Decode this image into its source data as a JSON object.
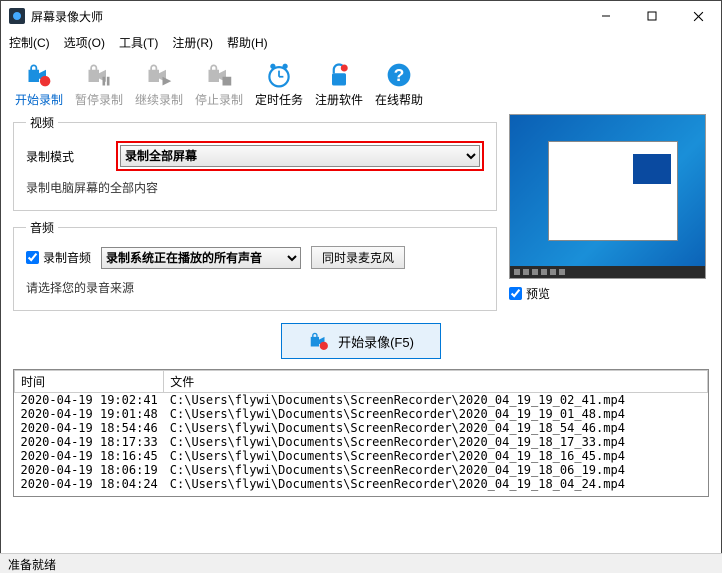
{
  "title": "屏幕录像大师",
  "menu": {
    "control": "控制(C)",
    "options": "选项(O)",
    "tools": "工具(T)",
    "register": "注册(R)",
    "help": "帮助(H)"
  },
  "toolbar": {
    "start": "开始录制",
    "pause": "暂停录制",
    "continue": "继续录制",
    "stop": "停止录制",
    "timer": "定时任务",
    "regsoft": "注册软件",
    "onlinehelp": "在线帮助"
  },
  "video": {
    "legend": "视频",
    "mode_label": "录制模式",
    "mode_value": "录制全部屏幕",
    "hint": "录制电脑屏幕的全部内容"
  },
  "audio": {
    "legend": "音频",
    "record_audio": "录制音频",
    "source_value": "录制系统正在播放的所有声音",
    "mic_btn": "同时录麦克风",
    "hint": "请选择您的录音来源"
  },
  "preview_label": "预览",
  "big_button": "开始录像(F5)",
  "list": {
    "col_time": "时间",
    "col_file": "文件",
    "rows": [
      {
        "time": "2020-04-19 19:02:41",
        "file": "C:\\Users\\flywi\\Documents\\ScreenRecorder\\2020_04_19_19_02_41.mp4"
      },
      {
        "time": "2020-04-19 19:01:48",
        "file": "C:\\Users\\flywi\\Documents\\ScreenRecorder\\2020_04_19_19_01_48.mp4"
      },
      {
        "time": "2020-04-19 18:54:46",
        "file": "C:\\Users\\flywi\\Documents\\ScreenRecorder\\2020_04_19_18_54_46.mp4"
      },
      {
        "time": "2020-04-19 18:17:33",
        "file": "C:\\Users\\flywi\\Documents\\ScreenRecorder\\2020_04_19_18_17_33.mp4"
      },
      {
        "time": "2020-04-19 18:16:45",
        "file": "C:\\Users\\flywi\\Documents\\ScreenRecorder\\2020_04_19_18_16_45.mp4"
      },
      {
        "time": "2020-04-19 18:06:19",
        "file": "C:\\Users\\flywi\\Documents\\ScreenRecorder\\2020_04_19_18_06_19.mp4"
      },
      {
        "time": "2020-04-19 18:04:24",
        "file": "C:\\Users\\flywi\\Documents\\ScreenRecorder\\2020_04_19_18_04_24.mp4"
      }
    ]
  },
  "status": "准备就绪",
  "colors": {
    "accent": "#0078d7",
    "highlight": "#e00"
  }
}
